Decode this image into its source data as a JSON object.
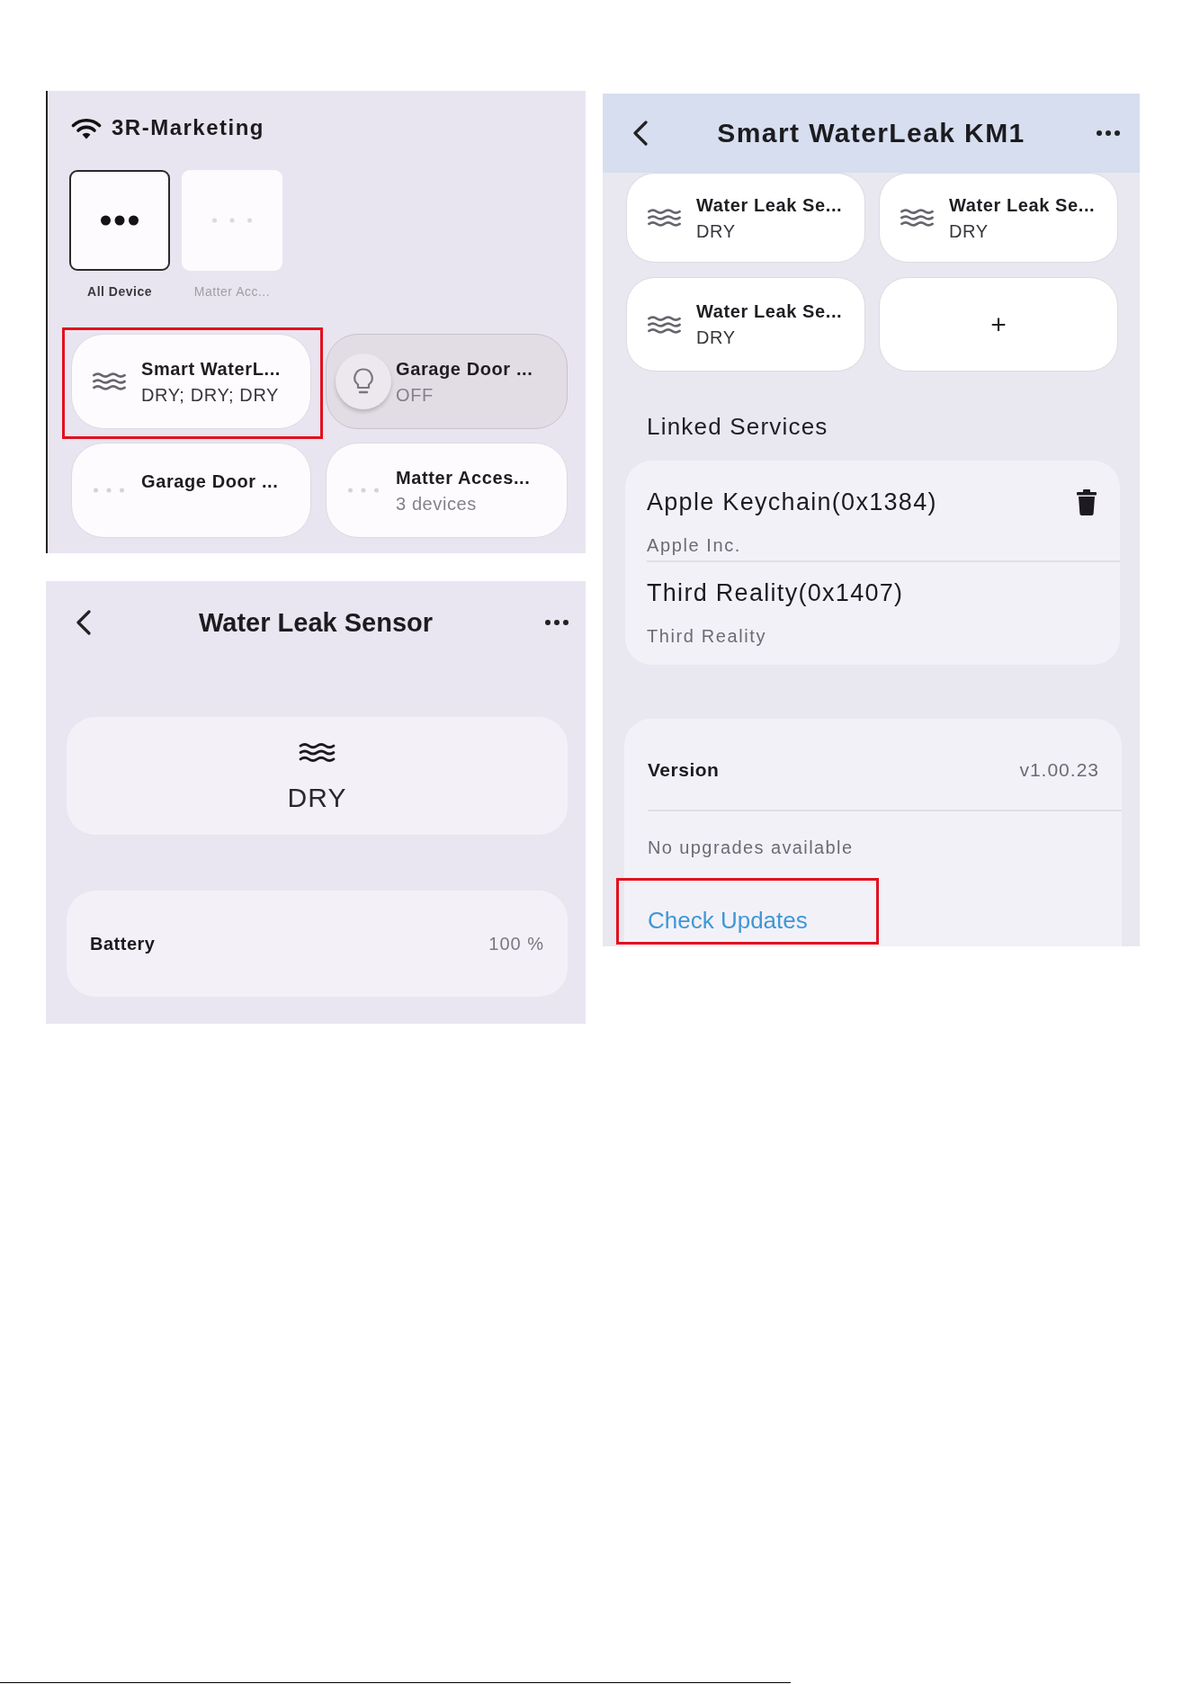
{
  "home": {
    "network": "3R-Marketing",
    "rooms": [
      {
        "label": "All Device",
        "selected": true
      },
      {
        "label": "Matter Acc...",
        "selected": false
      }
    ],
    "devices": [
      {
        "kind": "water_sensor",
        "name": "Smart WaterL...",
        "status": "DRY; DRY; DRY",
        "on": true,
        "highlighted": true
      },
      {
        "kind": "light",
        "name": "Garage Door ...",
        "status": "OFF",
        "on": false,
        "highlighted": false
      },
      {
        "kind": "placeholder",
        "name": "Garage Door ...",
        "on": true,
        "highlighted": false
      },
      {
        "kind": "placeholder",
        "name": "Matter Acces...",
        "status": "3 devices",
        "on": true,
        "highlighted": false
      }
    ]
  },
  "sensor_screen": {
    "title": "Water Leak Sensor",
    "state": "DRY",
    "battery": {
      "label": "Battery",
      "value": "100 %"
    }
  },
  "device_screen": {
    "title": "Smart WaterLeak KM1",
    "sub_devices": [
      {
        "kind": "water_sensor",
        "name": "Water Leak Se...",
        "status": "DRY"
      },
      {
        "kind": "water_sensor",
        "name": "Water Leak Se...",
        "status": "DRY"
      },
      {
        "kind": "water_sensor",
        "name": "Water Leak Se...",
        "status": "DRY"
      }
    ],
    "add_button": {
      "label": "+"
    },
    "linked_services": {
      "heading": "Linked Services",
      "items": [
        {
          "name": "Apple Keychain(0x1384)",
          "vendor": "Apple Inc.",
          "deletable": true
        },
        {
          "name": "Third Reality(0x1407)",
          "vendor": "Third Reality",
          "deletable": false
        }
      ]
    },
    "firmware": {
      "label": "Version",
      "value": "v1.00.23",
      "message": "No upgrades available",
      "action": {
        "label": "Check Updates",
        "highlighted": true
      }
    }
  }
}
